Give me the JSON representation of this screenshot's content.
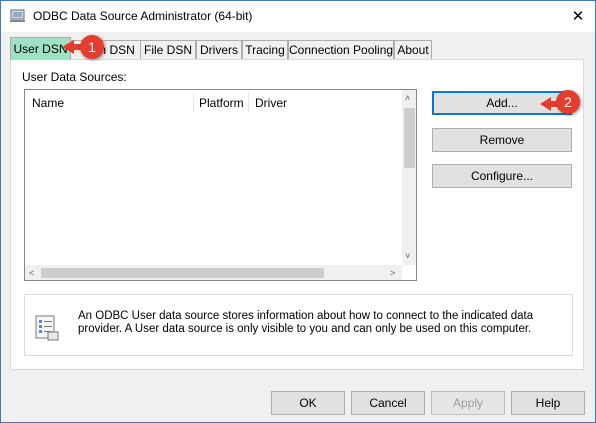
{
  "window": {
    "title": "ODBC Data Source Administrator (64-bit)",
    "close": "✕",
    "icon": "odbc-app-icon",
    "border_color": "#3b79c4"
  },
  "tabs": [
    "User DSN",
    "System DSN",
    "File DSN",
    "Drivers",
    "Tracing",
    "Connection Pooling",
    "About"
  ],
  "active_tab_color": "#9fe2c3",
  "tab_overlap_text": "m DSN",
  "user_dsn": {
    "section_label": "User Data Sources:",
    "columns": [
      "Name",
      "Platform",
      "Driver"
    ],
    "buttons": {
      "add": "Add...",
      "remove": "Remove",
      "configure": "Configure..."
    },
    "info_text": "An ODBC User data source stores information about how to connect to the indicated data provider.   A User data source is only visible to you and can only be used on this computer.",
    "info_icon": "data-source-icon"
  },
  "scroll": {
    "up": "˄",
    "down": "˅",
    "left": "<",
    "right": ">"
  },
  "footer": {
    "ok": "OK",
    "cancel": "Cancel",
    "apply": "Apply",
    "help": "Help"
  },
  "annotations": {
    "badge1": "1",
    "badge2": "2",
    "color": "#e53d2d"
  }
}
